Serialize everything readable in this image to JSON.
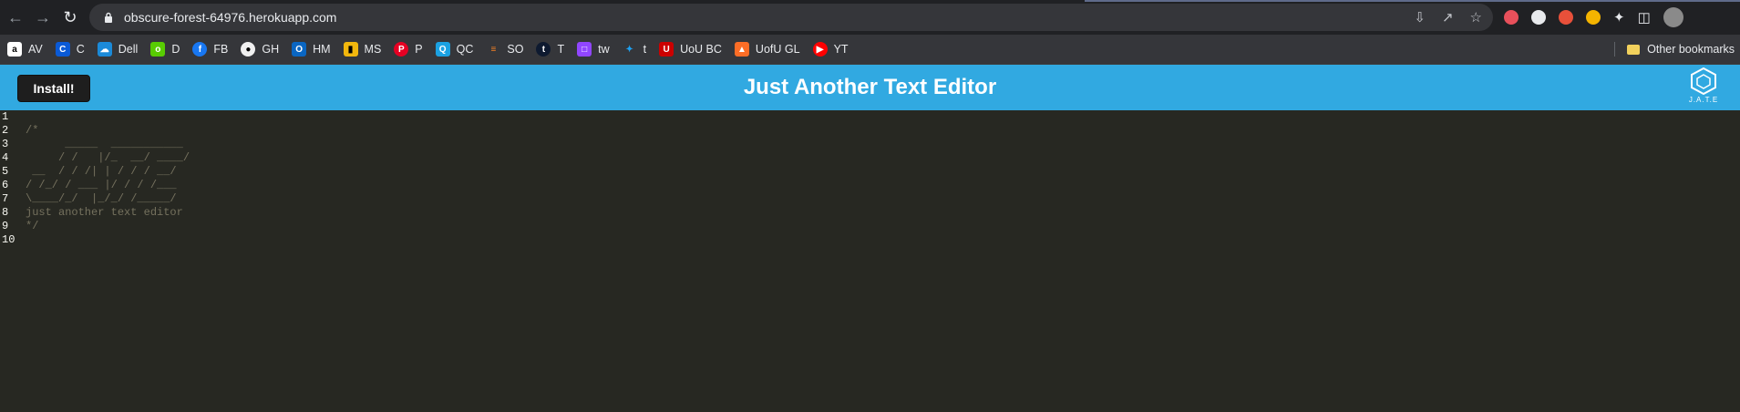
{
  "browser": {
    "url": "obscure-forest-64976.herokuapp.com",
    "bookmarks": [
      {
        "label": "AV",
        "color": "#ffffff"
      },
      {
        "label": "C",
        "color": "#0a5ad6"
      },
      {
        "label": "Dell",
        "color": "#1b8ad8"
      },
      {
        "label": "D",
        "color": "#58cc02"
      },
      {
        "label": "FB",
        "color": "#1877f2"
      },
      {
        "label": "GH",
        "color": "#f0f0f0"
      },
      {
        "label": "HM",
        "color": "#0a66c2"
      },
      {
        "label": "MS",
        "color": "#f2b70d"
      },
      {
        "label": "P",
        "color": "#e60023"
      },
      {
        "label": "QC",
        "color": "#1ba1e2"
      },
      {
        "label": "SO",
        "color": "#f48024"
      },
      {
        "label": "T",
        "color": "#0e1a30"
      },
      {
        "label": "tw",
        "color": "#9146ff"
      },
      {
        "label": "t",
        "color": "#1da1f2"
      },
      {
        "label": "UoU BC",
        "color": "#cc0000"
      },
      {
        "label": "UofU GL",
        "color": "#fc6d26"
      },
      {
        "label": "YT",
        "color": "#ff0000"
      }
    ],
    "other_bookmarks": "Other bookmarks"
  },
  "app": {
    "install_label": "Install!",
    "title": "Just Another Text Editor",
    "logo_text": "J.A.T.E"
  },
  "editor": {
    "lines": [
      {
        "num": "1",
        "text": ""
      },
      {
        "num": "2",
        "text": "/*"
      },
      {
        "num": "3",
        "text": "      _____  ___________"
      },
      {
        "num": "4",
        "text": "     / /   |/_  __/ ____/"
      },
      {
        "num": "5",
        "text": " __  / / /| | / / / __/"
      },
      {
        "num": "6",
        "text": "/ /_/ / ___ |/ / / /___"
      },
      {
        "num": "7",
        "text": "\\____/_/  |_/_/ /_____/"
      },
      {
        "num": "8",
        "text": "just another text editor"
      },
      {
        "num": "9",
        "text": "*/"
      },
      {
        "num": "10",
        "text": ""
      }
    ]
  }
}
